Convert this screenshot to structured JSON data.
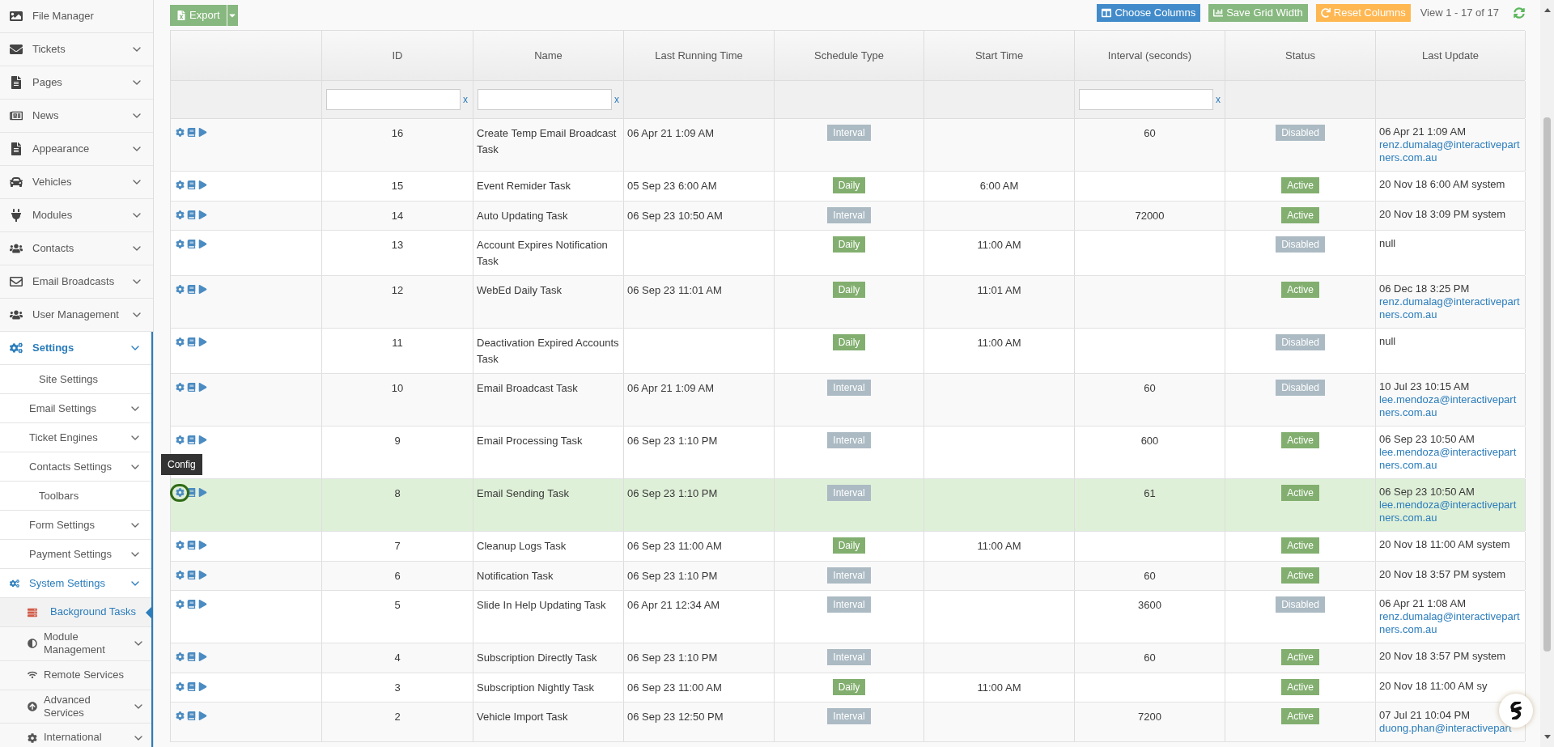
{
  "sidebar": {
    "items": [
      {
        "label": "File Manager",
        "expandable": false,
        "expanded": false
      },
      {
        "label": "Tickets",
        "expandable": true,
        "expanded": false
      },
      {
        "label": "Pages",
        "expandable": true,
        "expanded": false
      },
      {
        "label": "News",
        "expandable": true,
        "expanded": false
      },
      {
        "label": "Appearance",
        "expandable": true,
        "expanded": false
      },
      {
        "label": "Vehicles",
        "expandable": true,
        "expanded": false
      },
      {
        "label": "Modules",
        "expandable": true,
        "expanded": false
      },
      {
        "label": "Contacts",
        "expandable": true,
        "expanded": false
      },
      {
        "label": "Email Broadcasts",
        "expandable": true,
        "expanded": false
      },
      {
        "label": "User Management",
        "expandable": true,
        "expanded": false
      },
      {
        "label": "Settings",
        "expandable": true,
        "expanded": true,
        "children": [
          {
            "label": "Site Settings",
            "expandable": false,
            "expanded": false
          },
          {
            "label": "Email Settings",
            "expandable": true,
            "expanded": false
          },
          {
            "label": "Ticket Engines",
            "expandable": true,
            "expanded": false
          },
          {
            "label": "Contacts Settings",
            "expandable": true,
            "expanded": false
          },
          {
            "label": "Toolbars",
            "expandable": false,
            "expanded": false
          },
          {
            "label": "Form Settings",
            "expandable": true,
            "expanded": false
          },
          {
            "label": "Payment Settings",
            "expandable": true,
            "expanded": false
          },
          {
            "label": "System Settings",
            "expandable": true,
            "expanded": true,
            "children": [
              {
                "label": "Background Tasks",
                "expandable": false,
                "selected": true
              },
              {
                "label": "Module Management",
                "expandable": true,
                "selected": false
              },
              {
                "label": "Remote Services",
                "expandable": false,
                "selected": false
              },
              {
                "label": "Advanced Services",
                "expandable": true,
                "selected": false
              },
              {
                "label": "International",
                "expandable": true,
                "selected": false
              }
            ]
          }
        ]
      }
    ]
  },
  "toolbar": {
    "export_button": "Export",
    "buttons": [
      {
        "label": "Choose Columns",
        "color": "#428bca"
      },
      {
        "label": "Save Grid Width",
        "color": "#87b87f"
      },
      {
        "label": "Reset Columns",
        "color": "#ffb752"
      }
    ],
    "record_count": "View 1 - 17 of 17"
  },
  "table": {
    "columns": [
      "ID",
      "Name",
      "Last Running Time",
      "Schedule Type",
      "Start Time",
      "Interval (seconds)",
      "Status",
      "Last Update"
    ],
    "filter_clear": [
      "x",
      "x",
      "x"
    ],
    "tooltip": "Config",
    "rows": [
      {
        "id": "16",
        "name": "Create Temp Email Broadcast Task",
        "last_running": "06 Apr 21 1:09 AM",
        "schedule": {
          "text": "Interval",
          "color": "#abbac3"
        },
        "interval": "60",
        "status": {
          "text": "Disabled",
          "color": "#abbac3"
        },
        "last_update": {
          "time": "06 Apr 21 1:09 AM",
          "user": {
            "text": "renz.dumalag@interactivepartners.com.au",
            "kind": "link"
          }
        },
        "selected": false
      },
      {
        "id": "15",
        "name": "Event Remider Task",
        "last_running": "05 Sep 23 6:00 AM",
        "schedule": {
          "text": "Daily",
          "color": "#82af6f"
        },
        "start_time": "6:00 AM",
        "status": {
          "text": "Active",
          "color": "#82af6f"
        },
        "last_update": {
          "time": "20 Nov 18 6:00 AM",
          "user": {
            "text": "system",
            "kind": "plain"
          }
        },
        "selected": false
      },
      {
        "id": "14",
        "name": "Auto Updating Task",
        "last_running": "06 Sep 23 10:50 AM",
        "schedule": {
          "text": "Interval",
          "color": "#abbac3"
        },
        "interval": "72000",
        "status": {
          "text": "Active",
          "color": "#82af6f"
        },
        "last_update": {
          "time": "20 Nov 18 3:09 PM",
          "user": {
            "text": "system",
            "kind": "plain"
          }
        },
        "selected": false
      },
      {
        "id": "13",
        "name": "Account Expires Notification Task",
        "schedule": {
          "text": "Daily",
          "color": "#82af6f"
        },
        "start_time": "11:00 AM",
        "status": {
          "text": "Disabled",
          "color": "#abbac3"
        },
        "last_update": {
          "time": "null"
        },
        "selected": false
      },
      {
        "id": "12",
        "name": "WebEd Daily Task",
        "last_running": "06 Sep 23 11:01 AM",
        "schedule": {
          "text": "Daily",
          "color": "#82af6f"
        },
        "start_time": "11:01 AM",
        "status": {
          "text": "Active",
          "color": "#82af6f"
        },
        "last_update": {
          "time": "06 Dec 18 3:25 PM",
          "user": {
            "text": "renz.dumalag@interactivepartners.com.au",
            "kind": "link"
          }
        },
        "selected": false
      },
      {
        "id": "11",
        "name": "Deactivation Expired Accounts Task",
        "schedule": {
          "text": "Daily",
          "color": "#82af6f"
        },
        "start_time": "11:00 AM",
        "status": {
          "text": "Disabled",
          "color": "#abbac3"
        },
        "last_update": {
          "time": "null"
        },
        "selected": false
      },
      {
        "id": "10",
        "name": "Email Broadcast Task",
        "last_running": "06 Apr 21 1:09 AM",
        "schedule": {
          "text": "Interval",
          "color": "#abbac3"
        },
        "interval": "60",
        "status": {
          "text": "Disabled",
          "color": "#abbac3"
        },
        "last_update": {
          "time": "10 Jul 23 10:15 AM",
          "user": {
            "text": "lee.mendoza@interactivepartners.com.au",
            "kind": "link"
          }
        },
        "selected": false
      },
      {
        "id": "9",
        "name": "Email Processing Task",
        "last_running": "06 Sep 23 1:10 PM",
        "schedule": {
          "text": "Interval",
          "color": "#abbac3"
        },
        "interval": "600",
        "status": {
          "text": "Active",
          "color": "#82af6f"
        },
        "last_update": {
          "time": "06 Sep 23 10:50 AM",
          "user": {
            "text": "lee.mendoza@interactivepartners.com.au",
            "kind": "link"
          }
        },
        "selected": false
      },
      {
        "id": "8",
        "name": "Email Sending Task",
        "last_running": "06 Sep 23 1:10 PM",
        "schedule": {
          "text": "Interval",
          "color": "#abbac3"
        },
        "interval": "61",
        "status": {
          "text": "Active",
          "color": "#82af6f"
        },
        "last_update": {
          "time": "06 Sep 23 10:50 AM",
          "user": {
            "text": "lee.mendoza@interactivepartners.com.au",
            "kind": "link"
          }
        },
        "selected": true
      },
      {
        "id": "7",
        "name": "Cleanup Logs Task",
        "last_running": "06 Sep 23 11:00 AM",
        "schedule": {
          "text": "Daily",
          "color": "#82af6f"
        },
        "start_time": "11:00 AM",
        "status": {
          "text": "Active",
          "color": "#82af6f"
        },
        "last_update": {
          "time": "20 Nov 18 11:00 AM",
          "user": {
            "text": "system",
            "kind": "plain"
          }
        },
        "selected": false
      },
      {
        "id": "6",
        "name": "Notification Task",
        "last_running": "06 Sep 23 1:10 PM",
        "schedule": {
          "text": "Interval",
          "color": "#abbac3"
        },
        "interval": "60",
        "status": {
          "text": "Active",
          "color": "#82af6f"
        },
        "last_update": {
          "time": "20 Nov 18 3:57 PM",
          "user": {
            "text": "system",
            "kind": "plain"
          }
        },
        "selected": false
      },
      {
        "id": "5",
        "name": "Slide In Help Updating Task",
        "last_running": "06 Apr 21 12:34 AM",
        "schedule": {
          "text": "Interval",
          "color": "#abbac3"
        },
        "interval": "3600",
        "status": {
          "text": "Disabled",
          "color": "#abbac3"
        },
        "last_update": {
          "time": "06 Apr 21 1:08 AM",
          "user": {
            "text": "renz.dumalag@interactivepartners.com.au",
            "kind": "link"
          }
        },
        "selected": false
      },
      {
        "id": "4",
        "name": "Subscription Directly Task",
        "last_running": "06 Sep 23 1:10 PM",
        "schedule": {
          "text": "Interval",
          "color": "#abbac3"
        },
        "interval": "60",
        "status": {
          "text": "Active",
          "color": "#82af6f"
        },
        "last_update": {
          "time": "20 Nov 18 3:57 PM",
          "user": {
            "text": "system",
            "kind": "plain"
          }
        },
        "selected": false
      },
      {
        "id": "3",
        "name": "Subscription Nightly Task",
        "last_running": "06 Sep 23 11:00 AM",
        "schedule": {
          "text": "Daily",
          "color": "#82af6f"
        },
        "start_time": "11:00 AM",
        "status": {
          "text": "Active",
          "color": "#82af6f"
        },
        "last_update": {
          "time": "20 Nov 18 11:00 AM",
          "user": {
            "text": "sy",
            "kind": "plain"
          }
        },
        "selected": false
      },
      {
        "id": "2",
        "name": "Vehicle Import Task",
        "last_running": "06 Sep 23 12:50 PM",
        "schedule": {
          "text": "Interval",
          "color": "#abbac3"
        },
        "interval": "7200",
        "status": {
          "text": "Active",
          "color": "#82af6f"
        },
        "last_update": {
          "time": "07 Jul 21 10:04 PM",
          "user": {
            "text": "duong.phan@interactivepart",
            "kind": "link"
          }
        },
        "selected": false
      }
    ]
  }
}
